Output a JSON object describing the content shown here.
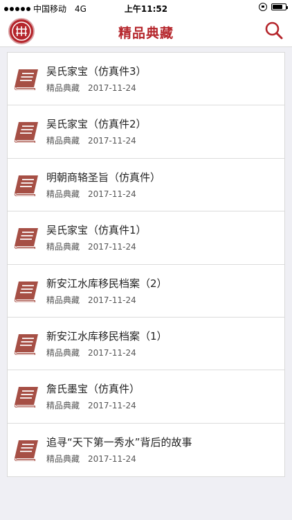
{
  "statusbar": {
    "carrier": "中国移动",
    "network": "4G",
    "time": "上午11:52",
    "battery_level": 0.8
  },
  "header": {
    "title": "精品典藏"
  },
  "colors": {
    "accent": "#b5252b",
    "book": "#a64f45"
  },
  "icons": {
    "logo": "logo-icon",
    "search": "search-icon",
    "item": "book-icon"
  },
  "items": [
    {
      "title": "吴氏家宝（仿真件3）",
      "category": "精品典藏",
      "date": "2017-11-24"
    },
    {
      "title": "吴氏家宝（仿真件2）",
      "category": "精品典藏",
      "date": "2017-11-24"
    },
    {
      "title": "明朝商辂圣旨（仿真件）",
      "category": "精品典藏",
      "date": "2017-11-24"
    },
    {
      "title": "吴氏家宝（仿真件1）",
      "category": "精品典藏",
      "date": "2017-11-24"
    },
    {
      "title": "新安江水库移民档案（2）",
      "category": "精品典藏",
      "date": "2017-11-24"
    },
    {
      "title": "新安江水库移民档案（1）",
      "category": "精品典藏",
      "date": "2017-11-24"
    },
    {
      "title": "詹氏墨宝（仿真件）",
      "category": "精品典藏",
      "date": "2017-11-24"
    },
    {
      "title": "追寻“天下第一秀水”背后的故事",
      "category": "精品典藏",
      "date": "2017-11-24"
    }
  ]
}
